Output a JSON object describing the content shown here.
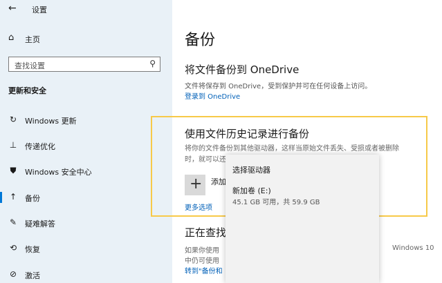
{
  "app": {
    "title": "设置"
  },
  "sidebar": {
    "home_label": "主页",
    "search_placeholder": "查找设置",
    "section_heading": "更新和安全",
    "items": [
      {
        "label": "Windows 更新",
        "icon": "sync-icon"
      },
      {
        "label": "传递优化",
        "icon": "delivery-optimization-icon"
      },
      {
        "label": "Windows 安全中心",
        "icon": "shield-icon"
      },
      {
        "label": "备份",
        "icon": "backup-arrow-icon",
        "selected": true
      },
      {
        "label": "疑难解答",
        "icon": "wrench-icon"
      },
      {
        "label": "恢复",
        "icon": "recovery-icon"
      },
      {
        "label": "激活",
        "icon": "activation-icon"
      }
    ]
  },
  "main": {
    "title": "备份",
    "onedrive": {
      "heading": "将文件备份到 OneDrive",
      "description": "文件将保存到 OneDrive，受到保护并可在任何设备上访问。",
      "link": "登录到 OneDrive"
    },
    "file_history": {
      "heading": "使用文件历史记录进行备份",
      "description_line1": "将你的文件备份到其他驱动器，这样当原始文件丢失、受损或者被删除",
      "description_line2": "时，就可以还",
      "add_label": "添加",
      "more_link": "更多选项"
    },
    "current": {
      "heading": "正在查找",
      "description_line1": "如果你使用",
      "description_line1_end": "Windows 10",
      "description_line2": "中仍可使用",
      "link": "转到\"备份和"
    }
  },
  "popup": {
    "title": "选择驱动器",
    "drive_name": "新加卷 (E:)",
    "drive_size": "45.1 GB 可用，共 59.9 GB"
  },
  "colors": {
    "sidebar_bg": "#e9f1f7",
    "accent": "#0078d7",
    "highlight_border": "#f7c948",
    "link": "#0060b8"
  }
}
